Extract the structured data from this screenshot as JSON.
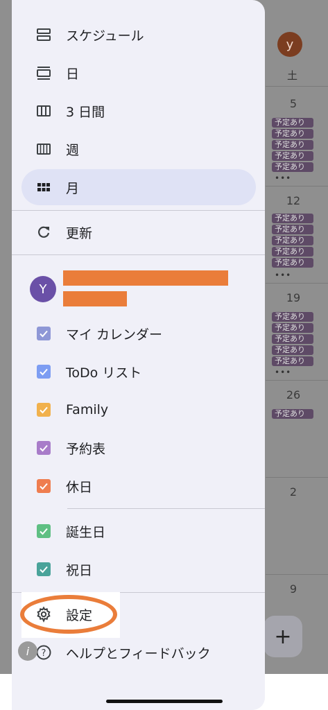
{
  "background": {
    "avatar_letter": "y",
    "weekday_label": "土",
    "dates": [
      "5",
      "12",
      "19",
      "26",
      "2",
      "9"
    ],
    "chip_label": "予定あり",
    "more_dots": "•••",
    "fab_symbol": "+"
  },
  "views": [
    {
      "label": "スケジュール",
      "icon": "schedule-icon"
    },
    {
      "label": "日",
      "icon": "day-view-icon"
    },
    {
      "label": "3 日間",
      "icon": "three-day-view-icon"
    },
    {
      "label": "週",
      "icon": "week-view-icon"
    },
    {
      "label": "月",
      "icon": "month-view-icon",
      "selected": true
    }
  ],
  "refresh": {
    "label": "更新",
    "icon": "refresh-icon"
  },
  "account": {
    "avatar_letter": "Y"
  },
  "calendars": [
    {
      "label": "マイ カレンダー",
      "color": "#8e97d6",
      "checked": true
    },
    {
      "label": "ToDo リスト",
      "color": "#7d9df2",
      "checked": true
    },
    {
      "label": "Family",
      "color": "#f1b14d",
      "checked": true
    },
    {
      "label": "予約表",
      "color": "#a87cc9",
      "checked": true
    },
    {
      "label": "休日",
      "color": "#ef7d4f",
      "checked": true
    }
  ],
  "other_calendars": [
    {
      "label": "誕生日",
      "color": "#5fbf83",
      "checked": true
    },
    {
      "label": "祝日",
      "color": "#4aa39a",
      "checked": true
    }
  ],
  "footer": [
    {
      "label": "設定",
      "icon": "gear-icon"
    },
    {
      "label": "ヘルプとフィードバック",
      "icon": "help-icon"
    }
  ],
  "colors": {
    "annotation": "#ea7d3a",
    "selected_bg": "#dfe2f5"
  }
}
